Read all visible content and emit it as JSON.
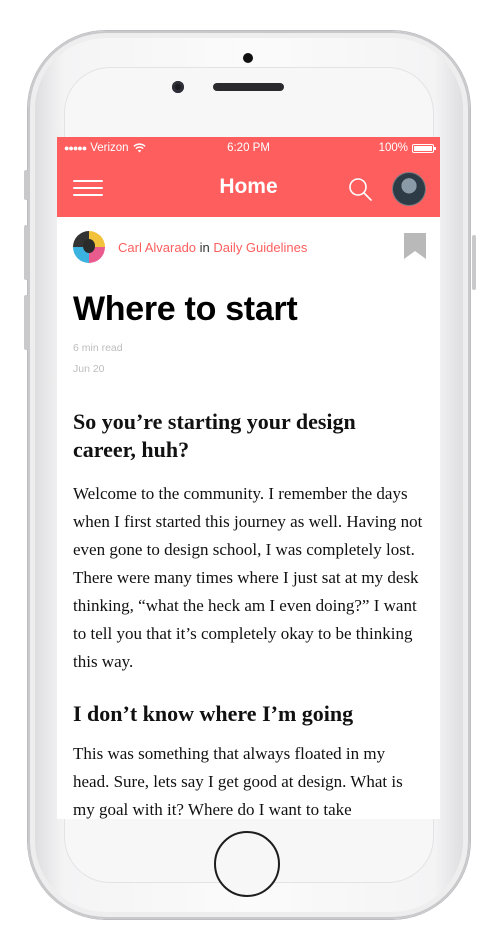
{
  "status_bar": {
    "signal": "●●●●●",
    "carrier": "Verizon",
    "wifi_icon": "wifi-icon",
    "time": "6:20 PM",
    "battery_text": "100%",
    "battery_level": 1.0
  },
  "navbar": {
    "title": "Home",
    "menu_icon": "hamburger-menu-icon",
    "search_icon": "search-icon",
    "background_color": "#fe5e5e"
  },
  "article": {
    "author": "Carl Alvarado",
    "in_word": "in",
    "publication": "Daily Guidelines",
    "bookmark_icon": "bookmark-icon",
    "title": "Where to start",
    "read_time": "6 min read",
    "date": "Jun 20",
    "sections": [
      {
        "heading": "So you’re starting your design career, huh?",
        "body": "Welcome to the community. I remember the days when I first started this journey as well. Having not even gone to design school, I was completely lost. There were many times where I just sat at my desk thinking, “what the heck am I even doing?” I want to tell you that it’s completely okay to be thinking this way."
      },
      {
        "heading": "I don’t know where I’m going",
        "body": "This was something that always floated in my head. Sure, lets say I get good at design. What is my goal with it? Where do I want to take"
      }
    ]
  },
  "colors": {
    "accent": "#fe5e5e",
    "text": "#111111",
    "meta": "#bdbdbd"
  }
}
